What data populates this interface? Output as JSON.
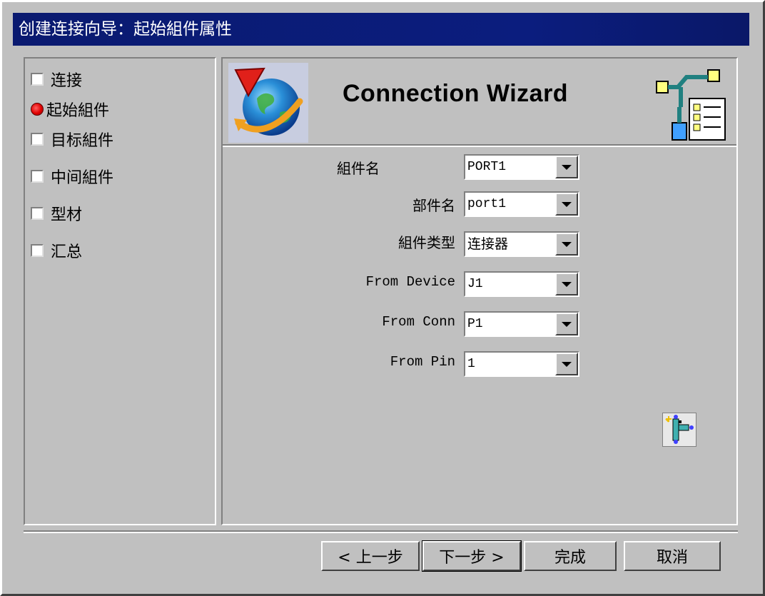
{
  "window": {
    "title": "创建连接向导：起始組件属性"
  },
  "steps": [
    {
      "label": "连接",
      "state": "unchecked"
    },
    {
      "label": "起始組件",
      "state": "current"
    },
    {
      "label": "目标組件",
      "state": "unchecked"
    },
    {
      "label": "中间組件",
      "state": "unchecked"
    },
    {
      "label": "型材",
      "state": "unchecked"
    },
    {
      "label": "汇总",
      "state": "unchecked"
    }
  ],
  "header": {
    "title": "Connection Wizard",
    "logo_icon": "globe-arrow-icon",
    "right_icon": "connection-diagram-icon"
  },
  "form": {
    "fields": [
      {
        "label": "組件名",
        "value": "PORT1"
      },
      {
        "label": "部件名",
        "value": "port1"
      },
      {
        "label": "組件类型",
        "value": "连接器"
      },
      {
        "label": "From Device",
        "value": "J1"
      },
      {
        "label": "From Conn",
        "value": "P1"
      },
      {
        "label": "From Pin",
        "value": "1"
      }
    ]
  },
  "tool_icon": "connector-tool-icon",
  "buttons": {
    "back": "< 上一步",
    "next": "下一步 >",
    "finish": "完成",
    "cancel": "取消"
  },
  "colors": {
    "title_bar": "#0b1d7e",
    "face": "#c0c0c0",
    "current_step_dot": "#e00000"
  }
}
